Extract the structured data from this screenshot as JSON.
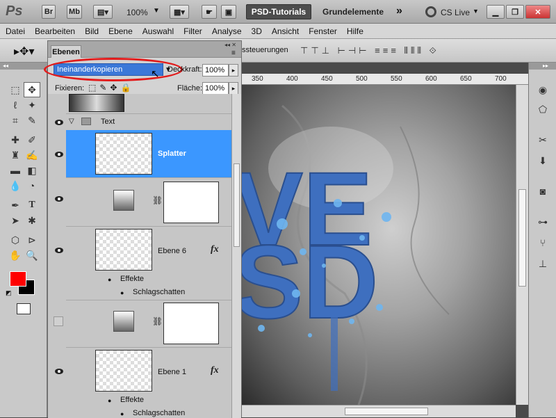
{
  "app": {
    "logo": "Ps",
    "bridge_label": "Br",
    "minibridge_label": "Mb",
    "zoom": "100%",
    "workspace_active": "PSD-Tutorials",
    "workspace_other": "Grundelemente",
    "more_label": "»",
    "cslive_label": "CS Live"
  },
  "menu": [
    "Datei",
    "Bearbeiten",
    "Bild",
    "Ebene",
    "Auswahl",
    "Filter",
    "Analyse",
    "3D",
    "Ansicht",
    "Fenster",
    "Hilfe"
  ],
  "options_bar": {
    "partial_label": "ssteuerungen"
  },
  "ruler": {
    "ticks": [
      "350",
      "400",
      "450",
      "500",
      "550",
      "600",
      "650",
      "700"
    ]
  },
  "canvas": {
    "letters_top": "VE",
    "letters_bottom": "SD"
  },
  "layers_panel": {
    "tab_label": "Ebenen",
    "blend_mode": "Ineinanderkopieren",
    "opacity_label": "Deckkraft:",
    "opacity_value": "100%",
    "lock_label": "Fixieren:",
    "fill_label": "Fläche:",
    "fill_value": "100%",
    "group_name": "Text",
    "layers": [
      {
        "name": "Splatter",
        "selected": true
      },
      {
        "name": "",
        "type": "adjustment"
      },
      {
        "name": "Ebene 6",
        "has_fx": true,
        "effects_label": "Effekte",
        "effect": "Schlagschatten"
      },
      {
        "name": "",
        "type": "adjustment"
      },
      {
        "name": "Ebene 1",
        "has_fx": true,
        "effects_label": "Effekte",
        "effect": "Schlagschatten"
      }
    ],
    "fx_label": "fx"
  },
  "colors": {
    "foreground": "#ff0000",
    "background": "#000000",
    "selection": "#3b97ff",
    "highlight_ellipse": "#e21b1b"
  }
}
